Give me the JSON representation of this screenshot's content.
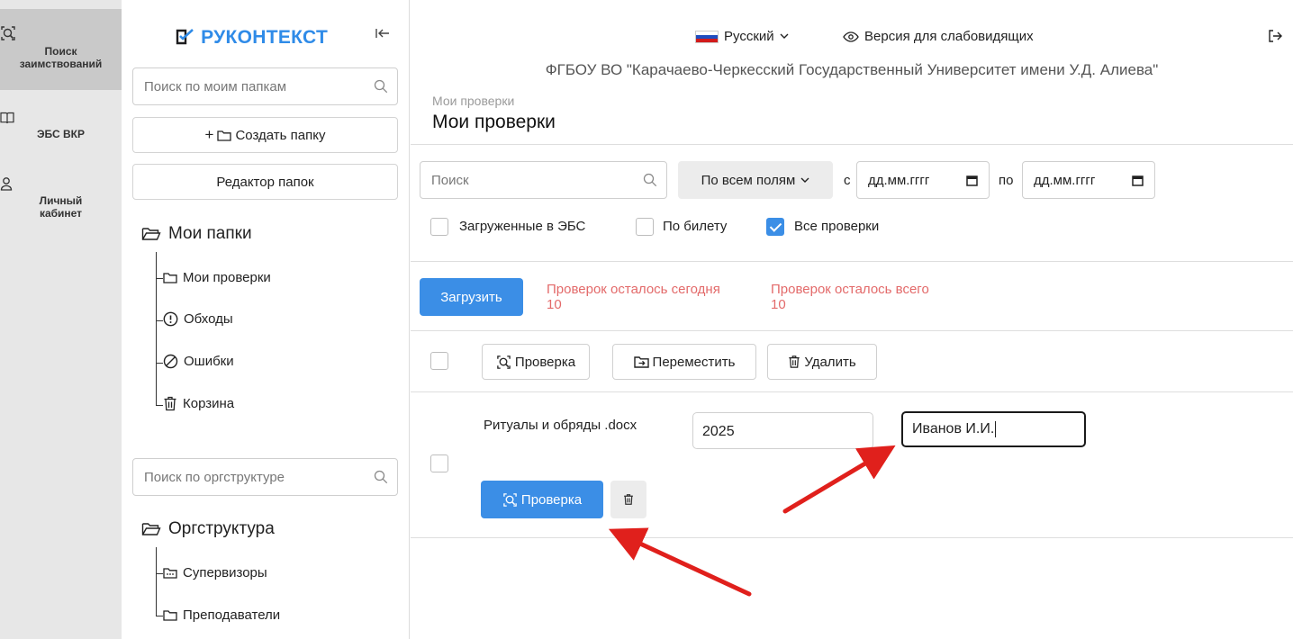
{
  "rail": {
    "items": [
      {
        "icon": "search-doc-icon",
        "label_line1": "Поиск",
        "label_line2": "заимствований",
        "active": true
      },
      {
        "icon": "book-icon",
        "label_line1": "ЭБС ВКР",
        "label_line2": ""
      },
      {
        "icon": "user-icon",
        "label_line1": "Личный",
        "label_line2": "кабинет"
      }
    ]
  },
  "sidebar": {
    "logo": "РУКОНТЕКСТ",
    "folder_search_placeholder": "Поиск по моим папкам",
    "create_folder_label": "Создать папку",
    "folder_editor_label": "Редактор папок",
    "my_folders_title": "Мои папки",
    "my_folders": [
      {
        "icon": "folder-icon",
        "label": "Мои проверки"
      },
      {
        "icon": "alert-circle-icon",
        "label": "Обходы"
      },
      {
        "icon": "ban-icon",
        "label": "Ошибки"
      },
      {
        "icon": "trash-icon",
        "label": "Корзина"
      }
    ],
    "org_search_placeholder": "Поиск по оргструктуре",
    "org_title": "Оргструктура",
    "org_items": [
      {
        "icon": "folder-dots-icon",
        "label": "Супервизоры"
      },
      {
        "icon": "folder-icon",
        "label": "Преподаватели"
      }
    ]
  },
  "topbar": {
    "language": "Русский",
    "low_vision": "Версия для слабовидящих",
    "organization": "ФГБОУ ВО \"Карачаево-Черкесский Государственный Университет имени У.Д. Алиева\""
  },
  "page": {
    "breadcrumb": "Мои проверки",
    "title": "Мои проверки"
  },
  "filters": {
    "search_placeholder": "Поиск",
    "field_select": "По всем полям",
    "from_label": "с",
    "to_label": "по",
    "date_placeholder": "дд.мм.гггг",
    "checkboxes": [
      {
        "label": "Загруженные в ЭБС",
        "checked": false
      },
      {
        "label": "По билету",
        "checked": false
      },
      {
        "label": "Все проверки",
        "checked": true
      }
    ]
  },
  "upload": {
    "button": "Загрузить",
    "quota_today_label": "Проверок осталось сегодня",
    "quota_today_value": "10",
    "quota_total_label": "Проверок осталось всего",
    "quota_total_value": "10"
  },
  "toolbar": {
    "check": "Проверка",
    "move": "Переместить",
    "delete": "Удалить"
  },
  "document": {
    "filename": "Ритуалы и обряды .docx",
    "year": "2025",
    "author": "Иванов И.И.",
    "check_button": "Проверка"
  },
  "colors": {
    "accent": "#3b8ee6",
    "quota": "#e36a6a",
    "arrow": "#e0201c"
  }
}
